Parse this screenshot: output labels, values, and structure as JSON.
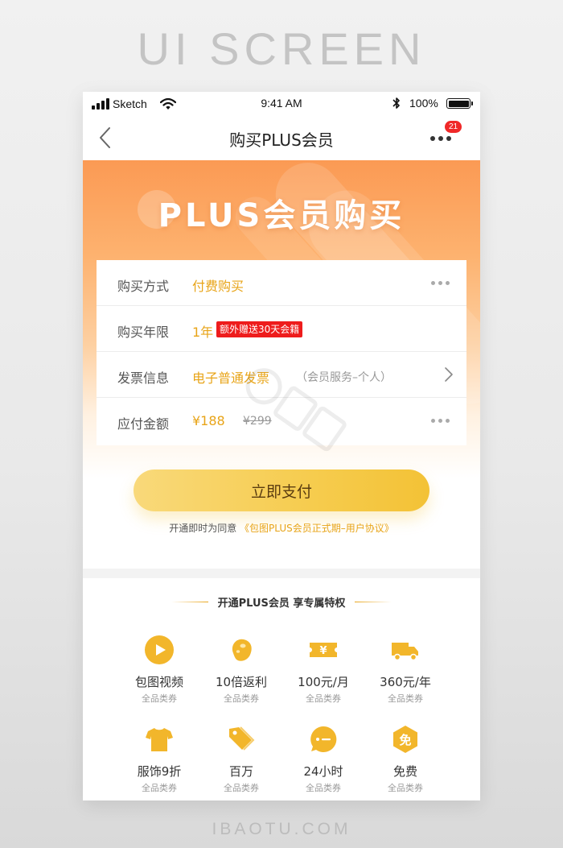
{
  "page": {
    "caption_top": "UI SCREEN",
    "caption_bottom": "IBAOTU.COM"
  },
  "status_bar": {
    "carrier": "Sketch",
    "time": "9:41 AM",
    "battery": "100%"
  },
  "nav": {
    "title": "购买PLUS会员",
    "badge_count": "21"
  },
  "hero": {
    "title": "PLUS会员购买"
  },
  "form": {
    "rows": [
      {
        "label": "购买方式",
        "value": "付费购买"
      },
      {
        "label": "购买年限",
        "value": "1年",
        "tag": "额外赠送30天会籍"
      },
      {
        "label": "发票信息",
        "value": "电子普通发票",
        "sub": "（会员服务–个人）"
      },
      {
        "label": "应付金额",
        "value": "¥188",
        "old_price": "¥299"
      }
    ]
  },
  "pay": {
    "button_label": "立即支付",
    "agreement_prefix": "开通即时为同意",
    "agreement_link": "《包图PLUS会员正式期–用户协议》"
  },
  "benefits": {
    "title": "开通PLUS会员  享专属特权",
    "items": [
      {
        "name": "包图视频",
        "sub": "全品类券",
        "icon": "play-icon"
      },
      {
        "name": "10倍返利",
        "sub": "全品类券",
        "icon": "bean-icon"
      },
      {
        "name": "100元/月",
        "sub": "全品类券",
        "icon": "yen-ticket-icon"
      },
      {
        "name": "360元/年",
        "sub": "全品类券",
        "icon": "truck-icon"
      },
      {
        "name": "服饰9折",
        "sub": "全品类券",
        "icon": "tshirt-icon"
      },
      {
        "name": "百万",
        "sub": "全品类券",
        "icon": "tag-icon"
      },
      {
        "name": "24小时",
        "sub": "全品类券",
        "icon": "chat-icon"
      },
      {
        "name": "免费",
        "sub": "全品类券",
        "icon": "free-icon",
        "icon_text": "免"
      }
    ]
  },
  "colors": {
    "accent": "#e8a418",
    "hero_orange": "#fb9a54",
    "tag_red": "#ee1c1c",
    "pay_yellow": "#f6cc4e"
  }
}
